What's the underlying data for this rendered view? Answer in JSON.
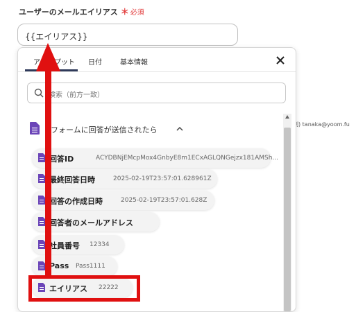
{
  "field": {
    "label": "ユーザーのメールエイリアス",
    "required_mark": "＊",
    "required_text": "必須",
    "value": "{{エイリアス}}"
  },
  "tabs": [
    "アウトプット",
    "日付",
    "基本情報"
  ],
  "active_tab": 0,
  "search": {
    "placeholder": "検索（前方一致）"
  },
  "group": {
    "title": "フォームに回答が送信されたら"
  },
  "items": [
    {
      "name": "回答ID",
      "value": "ACYDBNjEMcpMox4GnbyE8m1ECxAGLQNGejzx181AMSh..."
    },
    {
      "name": "最終回答日時",
      "value": "2025-02-19T23:57:01.628961Z"
    },
    {
      "name": "回答の作成日時",
      "value": "2025-02-19T23:57:01.628Z"
    },
    {
      "name": "回答者のメールアドレス",
      "value": ""
    },
    {
      "name": "社員番号",
      "value": "12334"
    },
    {
      "name": "Pass",
      "value": "Pass1111"
    },
    {
      "name": "エイリアス",
      "value": "22222"
    }
  ],
  "outside_text": "例) tanaka@yoom.fu",
  "colors": {
    "accent_tab": "#2f3a5a",
    "form_icon": "#6b45b8",
    "highlight": "#e01010",
    "required": "#e23d3d"
  }
}
